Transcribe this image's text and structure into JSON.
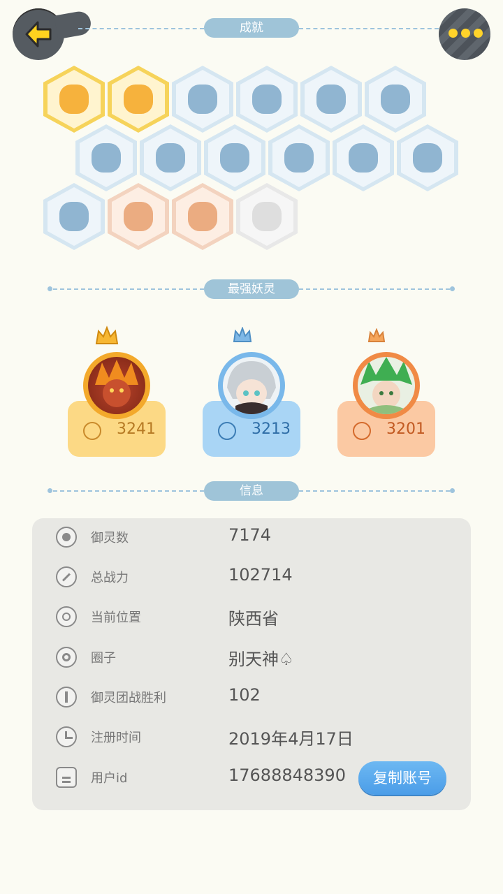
{
  "sections": {
    "achievements": "成就",
    "strongest": "最强妖灵",
    "info": "信息"
  },
  "achievements": [
    {
      "style": "gold",
      "icon": "fox-face-icon"
    },
    {
      "style": "gold",
      "icon": "golden-orb-icon"
    },
    {
      "style": "blue",
      "icon": "shoe-icon"
    },
    {
      "style": "blue",
      "icon": "magic-mirror-icon"
    },
    {
      "style": "blue",
      "icon": "moon-eclipse-icon"
    },
    {
      "style": "blue",
      "icon": "crystal-egg-icon"
    },
    {
      "style": "blue",
      "icon": "spirit-statue-icon"
    },
    {
      "style": "blue",
      "icon": "cat-cart-icon"
    },
    {
      "style": "blue",
      "icon": "yin-yang-box-icon"
    },
    {
      "style": "blue",
      "icon": "banner-icon"
    },
    {
      "style": "blue",
      "icon": "horned-statue-icon"
    },
    {
      "style": "blue",
      "icon": "cat-statue-icon"
    },
    {
      "style": "blue",
      "icon": "fox-book-icon"
    },
    {
      "style": "peach",
      "icon": "yin-yang-swirl-icon"
    },
    {
      "style": "peach",
      "icon": "cat-lollipop-icon"
    },
    {
      "style": "gray",
      "icon": "ghost-figure-icon"
    }
  ],
  "top_spirits": [
    {
      "power": "3241",
      "theme": "gold",
      "crown": "gold"
    },
    {
      "power": "3213",
      "theme": "blue",
      "crown": "blue"
    },
    {
      "power": "3201",
      "theme": "orange",
      "crown": "orange"
    }
  ],
  "info_rows": [
    {
      "label": "御灵数",
      "value": "7174",
      "icon": "spirit-count-icon"
    },
    {
      "label": "总战力",
      "value": "102714",
      "icon": "sword-icon"
    },
    {
      "label": "当前位置",
      "value": "陕西省",
      "icon": "location-pin-icon"
    },
    {
      "label": "圈子",
      "value": "别天神♤",
      "icon": "circle-target-icon"
    },
    {
      "label": "御灵团战胜利",
      "value": "102",
      "icon": "tower-icon"
    },
    {
      "label": "注册时间",
      "value": "2019年4月17日",
      "icon": "clock-icon"
    },
    {
      "label": "用户id",
      "value": "17688848390",
      "icon": "id-card-icon"
    }
  ],
  "copy_button": "复制账号",
  "colors": {
    "gold_card": "#fcd985",
    "blue_card": "#a9d5f5",
    "orange_card": "#fbc9a3",
    "accent_blue": "#4b9de8"
  }
}
